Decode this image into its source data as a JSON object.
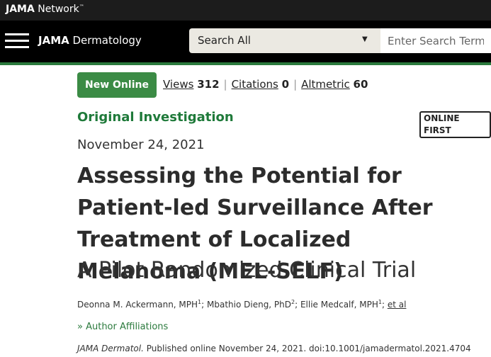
{
  "topbar": {
    "brand_bold": "JAMA",
    "brand_rest": " Network",
    "trademark": "™"
  },
  "navbar": {
    "menu_icon": "hamburger-menu-icon",
    "journal_bold": "JAMA",
    "journal_rest": " Dermatology",
    "search_scope": "Search All",
    "search_placeholder": "Enter Search Term"
  },
  "colors": {
    "accent_green": "#2b7a3d",
    "badge_green": "#3b8b45",
    "nav_black": "#000000"
  },
  "article": {
    "badge": "New Online",
    "metrics": {
      "views_label": "Views",
      "views_value": "312",
      "citations_label": "Citations",
      "citations_value": "0",
      "altmetric_label": "Altmetric",
      "altmetric_value": "60"
    },
    "type": "Original Investigation",
    "online_first": "ONLINE FIRST",
    "date": "November 24, 2021",
    "title": "Assessing the Potential for Patient-led Surveillance After Treatment of Localized Melanoma (MEL-SELF)",
    "subtitle": "A Pilot Randomized Clinical Trial",
    "authors": [
      {
        "name": "Deonna M. Ackermann, MPH",
        "aff": "1"
      },
      {
        "name": "Mbathio Dieng, PhD",
        "aff": "2"
      },
      {
        "name": "Ellie Medcalf, MPH",
        "aff": "1"
      }
    ],
    "et_al": "et al",
    "affiliations_toggle": "» Author Affiliations",
    "citation": {
      "journal": "JAMA Dermatol.",
      "text": " Published online November 24, 2021. doi:10.1001/jamadermatol.2021.4704"
    }
  }
}
